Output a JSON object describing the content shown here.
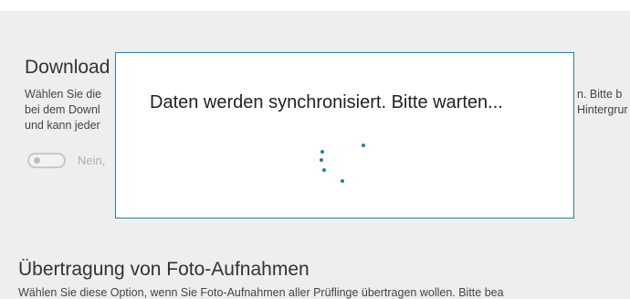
{
  "download_section": {
    "title": "Download",
    "lines": [
      "Wählen Sie die",
      "bei dem Downl",
      "und kann jeder"
    ],
    "right_lines": [
      "n. Bitte b",
      "Hintergrur"
    ],
    "toggle_label": "Nein,",
    "toggle_on": false
  },
  "dialog": {
    "message": "Daten werden synchronisiert. Bitte warten...",
    "spinner": "loading-spinner-icon"
  },
  "photo_section": {
    "title": "Übertragung von Foto-Aufnahmen",
    "line": "Wählen Sie diese Option, wenn Sie Foto-Aufnahmen aller Prüflinge übertragen wollen. Bitte bea"
  },
  "colors": {
    "background": "#eeeeee",
    "dialog_border": "#2e7d9a",
    "spinner": "#2a7f95"
  }
}
